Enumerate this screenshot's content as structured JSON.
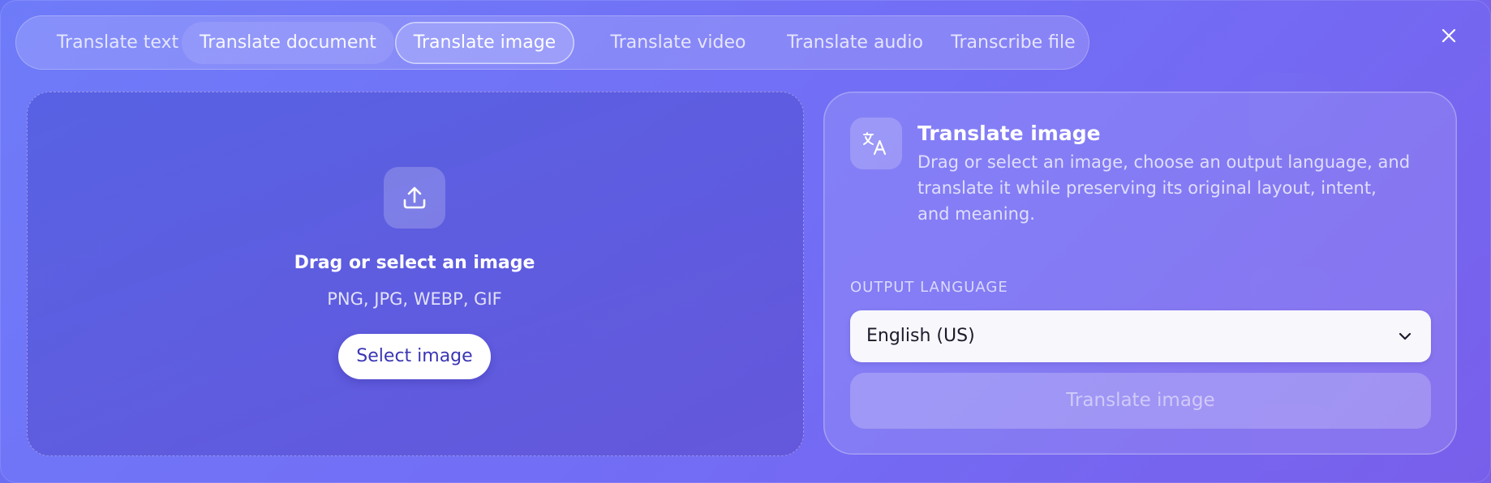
{
  "tabs": [
    {
      "label": "Translate text"
    },
    {
      "label": "Translate document"
    },
    {
      "label": "Translate image"
    },
    {
      "label": "Translate video"
    },
    {
      "label": "Translate audio"
    },
    {
      "label": "Transcribe file"
    }
  ],
  "active_tab": "Translate image",
  "dropzone": {
    "title": "Drag or select an image",
    "formats": "PNG, JPG, WEBP, GIF",
    "button_label": "Select image",
    "icon": "upload-icon"
  },
  "info": {
    "icon": "translate-icon",
    "title": "Translate image",
    "description": "Drag or select an image, choose an output language, and translate it while preserving its original layout, intent, and meaning."
  },
  "output_language": {
    "label": "OUTPUT LANGUAGE",
    "selected": "English (US)"
  },
  "translate_button_label": "Translate image",
  "colors": {
    "accent": "#6f6af1",
    "button_text": "#3b35b5"
  }
}
